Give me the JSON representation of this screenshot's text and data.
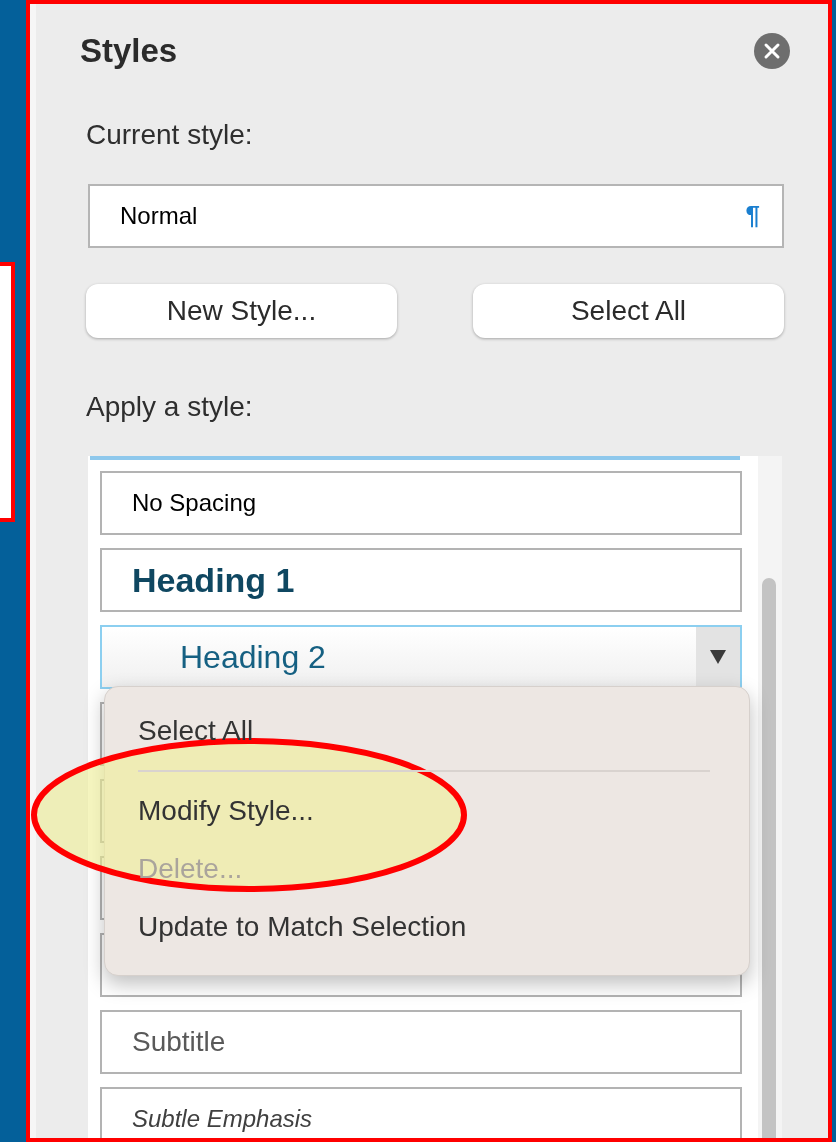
{
  "panel": {
    "title": "Styles"
  },
  "current_style": {
    "label": "Current style:",
    "value": "Normal",
    "mark": "¶"
  },
  "buttons": [
    "New Style...",
    "Select All"
  ],
  "apply_label": "Apply a style:",
  "styles": [
    {
      "kind": "plain",
      "label": "No Spacing",
      "selected": false
    },
    {
      "kind": "heading1",
      "label": "Heading 1",
      "selected": false
    },
    {
      "kind": "heading2",
      "label": "Heading 2",
      "selected": true
    },
    {
      "kind": "covered",
      "selected": false
    },
    {
      "kind": "covered",
      "selected": false
    },
    {
      "kind": "covered",
      "selected": false
    },
    {
      "kind": "covered",
      "selected": false
    },
    {
      "kind": "subtitle",
      "label": "Subtitle",
      "selected": false
    },
    {
      "kind": "emphasis",
      "label": "Subtle Emphasis",
      "selected": false
    }
  ],
  "context_menu": [
    {
      "kind": "item",
      "label": "Select All",
      "disabled": false
    },
    {
      "kind": "separator"
    },
    {
      "kind": "item",
      "label": "Modify Style...",
      "disabled": false,
      "highlighted": true
    },
    {
      "kind": "item",
      "label": "Delete...",
      "disabled": true
    },
    {
      "kind": "item",
      "label": "Update to Match Selection",
      "disabled": false
    }
  ]
}
